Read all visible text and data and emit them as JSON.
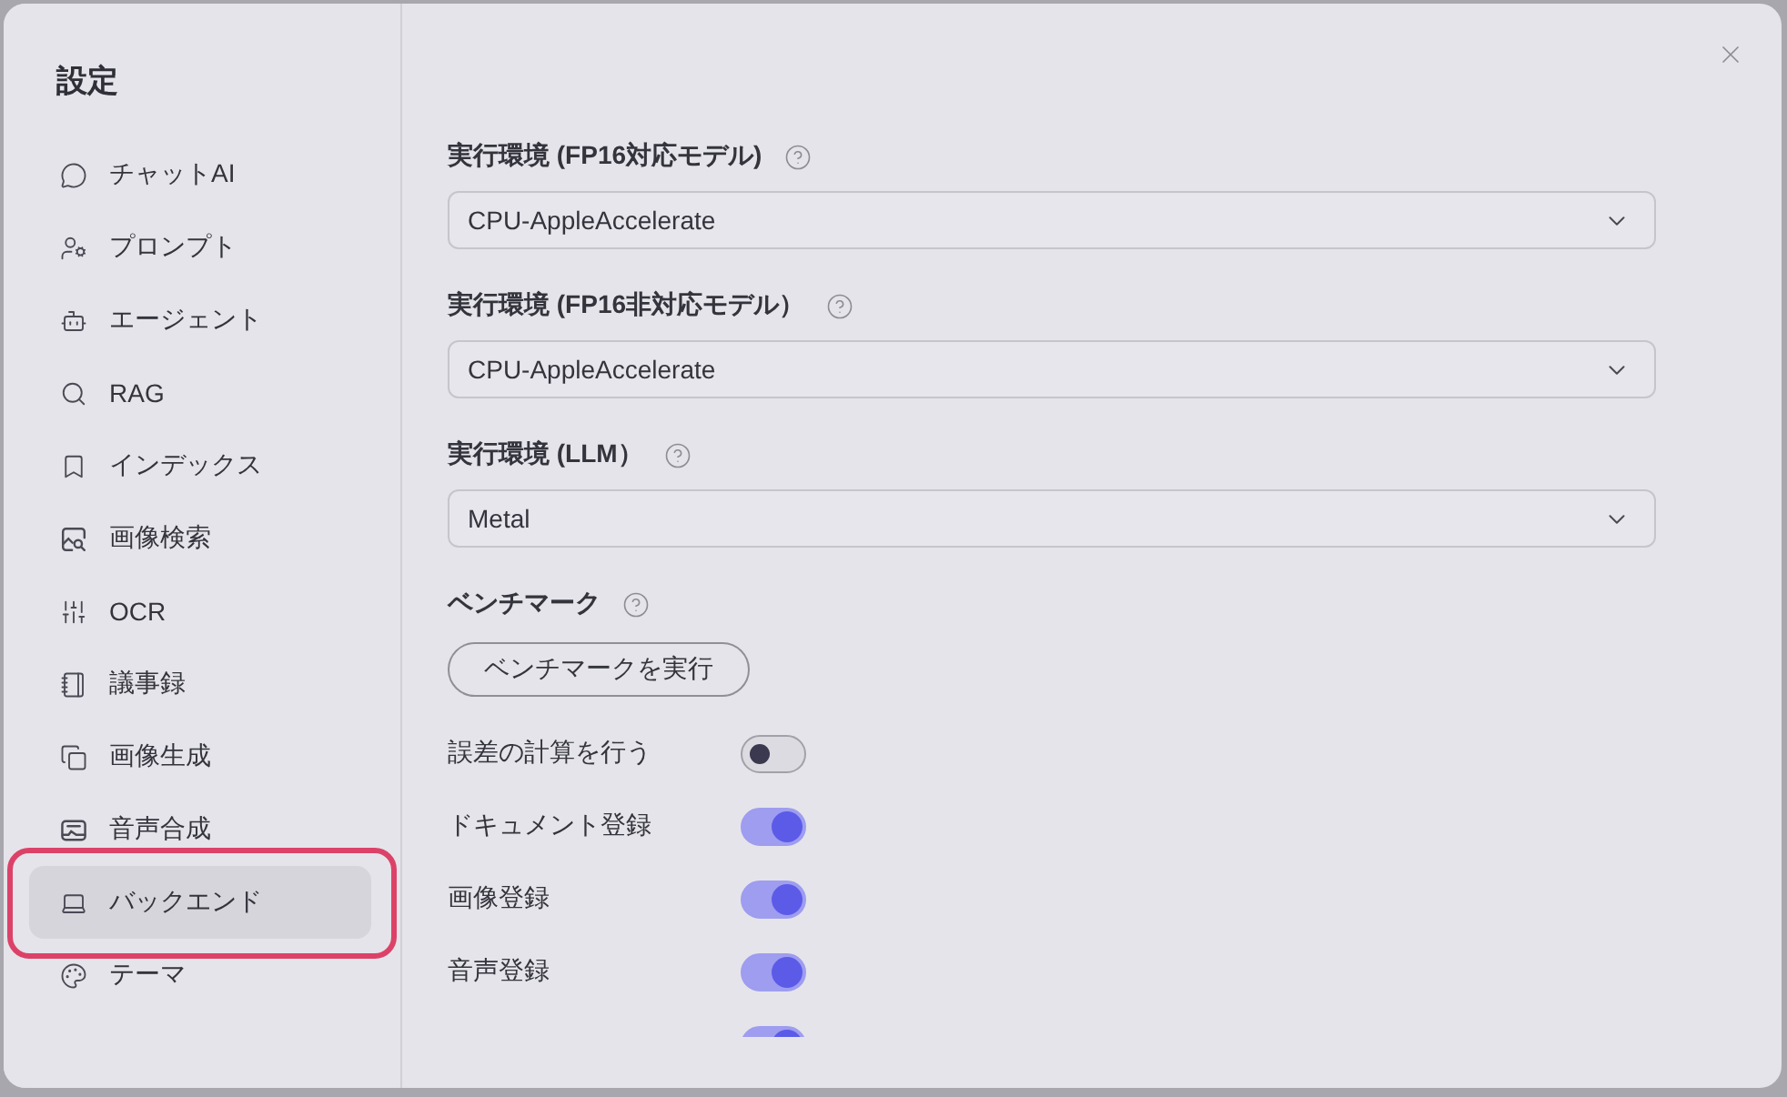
{
  "sidebar": {
    "title": "設定",
    "items": [
      {
        "label": "チャットAI",
        "selected": false,
        "highlighted": false
      },
      {
        "label": "プロンプト",
        "selected": false,
        "highlighted": false
      },
      {
        "label": "エージェント",
        "selected": false,
        "highlighted": false
      },
      {
        "label": "RAG",
        "selected": false,
        "highlighted": false
      },
      {
        "label": "インデックス",
        "selected": false,
        "highlighted": false
      },
      {
        "label": "画像検索",
        "selected": false,
        "highlighted": false
      },
      {
        "label": "OCR",
        "selected": false,
        "highlighted": false
      },
      {
        "label": "議事録",
        "selected": false,
        "highlighted": false
      },
      {
        "label": "画像生成",
        "selected": false,
        "highlighted": false
      },
      {
        "label": "音声合成",
        "selected": false,
        "highlighted": false
      },
      {
        "label": "バックエンド",
        "selected": true,
        "highlighted": true
      },
      {
        "label": "テーマ",
        "selected": false,
        "highlighted": false
      }
    ]
  },
  "main": {
    "selects": [
      {
        "label": "実行環境 (FP16対応モデル)",
        "value": "CPU-AppleAccelerate"
      },
      {
        "label": "実行環境 (FP16非対応モデル）",
        "value": "CPU-AppleAccelerate"
      },
      {
        "label": "実行環境 (LLM）",
        "value": "Metal"
      }
    ],
    "benchmark": {
      "label": "ベンチマーク",
      "button": "ベンチマークを実行"
    },
    "toggles": [
      {
        "label": "誤差の計算を行う",
        "on": false
      },
      {
        "label": "ドキュメント登録",
        "on": true
      },
      {
        "label": "画像登録",
        "on": true
      },
      {
        "label": "音声登録",
        "on": true
      },
      {
        "on": true
      }
    ]
  }
}
